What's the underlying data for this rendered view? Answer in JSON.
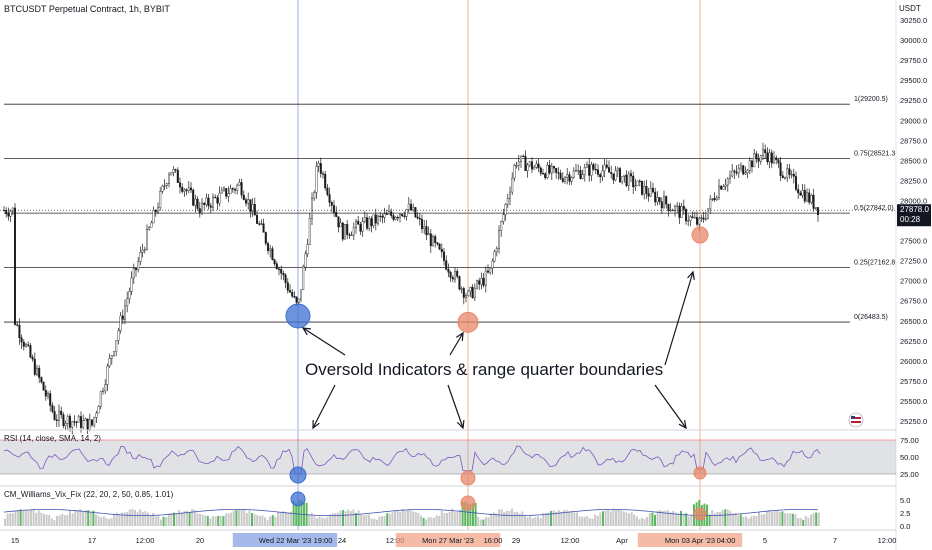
{
  "header": {
    "title": "BTCUSDT Perpetual Contract, 1h, BYBIT",
    "currency": "USDT"
  },
  "colors": {
    "up": "#1a1a1a",
    "down": "#1a1a1a",
    "fib_line": "#2a2a2a",
    "blue_circle": "#3d6fd1",
    "orange_circle": "#e8876a",
    "rsi_line": "#7e57c2",
    "rsi_band": "#9598a1",
    "wvf_green": "#4caf50",
    "wvf_gray": "#9e9e9e",
    "wvf_line": "#3f51b5",
    "vline_blue": "#7e9be0",
    "vline_orange": "#f0a080",
    "price_tag": "#131722"
  },
  "price_axis": {
    "ticks": [
      "30250.0",
      "30000.0",
      "29750.0",
      "29500.0",
      "29250.0",
      "29000.0",
      "28750.0",
      "28500.0",
      "28250.0",
      "28000.0",
      "27750.0",
      "27500.0",
      "27250.0",
      "27000.0",
      "26750.0",
      "26500.0",
      "26250.0",
      "26000.0",
      "25750.0",
      "25500.0",
      "25250.0"
    ],
    "current_price": "27878.0",
    "countdown": "00:28"
  },
  "fib_levels": [
    {
      "label": "1(29200.5)",
      "value": 29200.5
    },
    {
      "label": "0.75(28521.3",
      "value": 28521.3
    },
    {
      "label": "0.5(27842.0)",
      "value": 27842.0
    },
    {
      "label": "0.25(27162.8",
      "value": 27162.8
    },
    {
      "label": "0(26483.5)",
      "value": 26483.5
    }
  ],
  "annotation": {
    "text": "Oversold Indicators & range quarter boundaries"
  },
  "rsi": {
    "legend": "RSI (14, close, SMA, 14, 2)",
    "ticks": [
      "75.00",
      "50.00",
      "25.00"
    ]
  },
  "wvf": {
    "legend": "CM_Williams_Vix_Fix (22, 20, 2, 50, 0.85, 1.01)",
    "ticks": [
      "5.0",
      "2.5",
      "0.0"
    ]
  },
  "time_axis": {
    "labels": [
      "15",
      "17",
      "12:00",
      "20",
      "Wed 22 Mar '23",
      "19:00",
      "24",
      "12:00",
      "Mon 27 Mar '23",
      "16:00",
      "29",
      "12:00",
      "Apr",
      "Mon 03 Apr '23",
      "04:00",
      "5",
      "7",
      "12:00"
    ]
  },
  "chart_data": {
    "type": "candlestick",
    "title": "BTCUSDT Perpetual Contract, 1h, BYBIT",
    "ylim": [
      25150,
      30450
    ],
    "y_unit": "USDT",
    "price_path_keypoints": [
      {
        "x": "15",
        "price": 26500
      },
      {
        "x": "16",
        "price": 25300
      },
      {
        "x": "17",
        "price": 25200
      },
      {
        "x": "18",
        "price": 27000
      },
      {
        "x": "19",
        "price": 28400
      },
      {
        "x": "20",
        "price": 27900
      },
      {
        "x": "21",
        "price": 28200
      },
      {
        "x": "Wed 22 Mar '23 19:00",
        "price": 26650
      },
      {
        "x": "23",
        "price": 28500
      },
      {
        "x": "24",
        "price": 27600
      },
      {
        "x": "26",
        "price": 27900
      },
      {
        "x": "Mon 27 Mar '23 16:00",
        "price": 26800
      },
      {
        "x": "28",
        "price": 27100
      },
      {
        "x": "29",
        "price": 28500
      },
      {
        "x": "30",
        "price": 28300
      },
      {
        "x": "31",
        "price": 28400
      },
      {
        "x": "Apr",
        "price": 28300
      },
      {
        "x": "Mon 03 Apr '23 04:00",
        "price": 27700
      },
      {
        "x": "4",
        "price": 28200
      },
      {
        "x": "5",
        "price": 28600
      },
      {
        "x": "6",
        "price": 27878
      }
    ],
    "oversold_markers": [
      {
        "time": "Wed 22 Mar '23 19:00",
        "price": 26560
      },
      {
        "time": "Mon 27 Mar '23 16:00",
        "price": 26480
      },
      {
        "time": "Mon 03 Apr '23 04:00",
        "price": 27570
      }
    ]
  }
}
